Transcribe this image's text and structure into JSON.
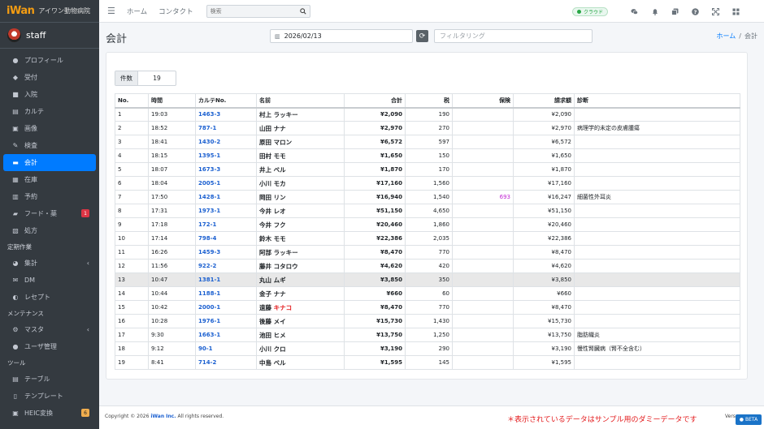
{
  "brand": {
    "logo_main": "iWan",
    "name": "アイワン動物病院"
  },
  "user": {
    "name": "staff"
  },
  "sidebar": {
    "items": [
      {
        "name": "profile",
        "label": "プロフィール",
        "icon": "user-icon",
        "glyph": "●"
      },
      {
        "name": "reception",
        "label": "受付",
        "icon": "dog-icon",
        "glyph": "◆"
      },
      {
        "name": "admission",
        "label": "入院",
        "icon": "bed-icon",
        "glyph": "■"
      },
      {
        "name": "karte",
        "label": "カルテ",
        "icon": "file-icon",
        "glyph": "▤"
      },
      {
        "name": "images",
        "label": "画像",
        "icon": "image-icon",
        "glyph": "▣"
      },
      {
        "name": "exam",
        "label": "検査",
        "icon": "syringe-icon",
        "glyph": "✎"
      },
      {
        "name": "accounting",
        "label": "会計",
        "icon": "card-icon",
        "glyph": "▬",
        "active": true
      },
      {
        "name": "inventory",
        "label": "在庫",
        "icon": "box-icon",
        "glyph": "▦"
      },
      {
        "name": "appointment",
        "label": "予約",
        "icon": "calendar-icon",
        "glyph": "▥"
      },
      {
        "name": "food",
        "label": "フード・薬",
        "icon": "folder-icon",
        "glyph": "▰",
        "badge": "1"
      },
      {
        "name": "prescription",
        "label": "処方",
        "icon": "pill-icon",
        "glyph": "▧"
      }
    ],
    "header_periodic": "定期作業",
    "periodic_items": [
      {
        "name": "aggregate",
        "label": "集計",
        "icon": "chart-pie-icon",
        "glyph": "◕",
        "chevron": "‹"
      },
      {
        "name": "dm",
        "label": "DM",
        "icon": "mail-icon",
        "glyph": "✉"
      },
      {
        "name": "receipt",
        "label": "レセプト",
        "icon": "circle-half-icon",
        "glyph": "◐"
      }
    ],
    "header_maintenance": "メンテナンス",
    "maintenance_items": [
      {
        "name": "master",
        "label": "マスタ",
        "icon": "gear-icon",
        "glyph": "⚙",
        "chevron": "‹"
      },
      {
        "name": "user-admin",
        "label": "ユーザ管理",
        "icon": "users-icon",
        "glyph": "●"
      }
    ],
    "header_tools": "ツール",
    "tool_items": [
      {
        "name": "table",
        "label": "テーブル",
        "icon": "table-icon",
        "glyph": "▤"
      },
      {
        "name": "template",
        "label": "テンプレート",
        "icon": "doc-icon",
        "glyph": "▯"
      },
      {
        "name": "heic",
        "label": "HEIC変換",
        "icon": "image-icon",
        "glyph": "▣",
        "badge_yellow": "6"
      }
    ]
  },
  "topbar": {
    "home_label": "ホーム",
    "contact_label": "コンタクト",
    "search_placeholder": "検索",
    "cloud_label": "クラウド"
  },
  "header": {
    "title": "会計",
    "date": "2026/02/13",
    "filter_placeholder": "フィルタリング",
    "breadcrumb_home": "ホーム",
    "breadcrumb_current": "会計"
  },
  "summary": {
    "count_label": "件数",
    "count_value": "19"
  },
  "table": {
    "headers": [
      "No.",
      "時間",
      "カルテNo.",
      "名前",
      "合計",
      "税",
      "保険",
      "請求額",
      "診断"
    ],
    "rows": [
      {
        "no": "1",
        "time": "19:03",
        "karte": "1463-3",
        "name": "村上 ラッキー",
        "total": "¥2,090",
        "tax": "190",
        "ins": "",
        "bill": "¥2,090",
        "diag": ""
      },
      {
        "no": "2",
        "time": "18:52",
        "karte": "787-1",
        "name": "山田 ナナ",
        "total": "¥2,970",
        "tax": "270",
        "ins": "",
        "bill": "¥2,970",
        "diag": "病理学的未定の皮膚腫瘍"
      },
      {
        "no": "3",
        "time": "18:41",
        "karte": "1430-2",
        "name": "原田 マロン",
        "total": "¥6,572",
        "tax": "597",
        "ins": "",
        "bill": "¥6,572",
        "diag": ""
      },
      {
        "no": "4",
        "time": "18:15",
        "karte": "1395-1",
        "name": "田村 モモ",
        "total": "¥1,650",
        "tax": "150",
        "ins": "",
        "bill": "¥1,650",
        "diag": ""
      },
      {
        "no": "5",
        "time": "18:07",
        "karte": "1673-3",
        "name": "井上 ベル",
        "total": "¥1,870",
        "tax": "170",
        "ins": "",
        "bill": "¥1,870",
        "diag": ""
      },
      {
        "no": "6",
        "time": "18:04",
        "karte": "2005-1",
        "name": "小川 モカ",
        "total": "¥17,160",
        "tax": "1,560",
        "ins": "",
        "bill": "¥17,160",
        "diag": ""
      },
      {
        "no": "7",
        "time": "17:50",
        "karte": "1428-1",
        "name": "岡田 リン",
        "total": "¥16,940",
        "tax": "1,540",
        "ins": "693",
        "bill": "¥16,247",
        "diag": "細菌性外耳炎"
      },
      {
        "no": "8",
        "time": "17:31",
        "karte": "1973-1",
        "name": "今井 レオ",
        "total": "¥51,150",
        "tax": "4,650",
        "ins": "",
        "bill": "¥51,150",
        "diag": ""
      },
      {
        "no": "9",
        "time": "17:18",
        "karte": "172-1",
        "name": "今井 フク",
        "total": "¥20,460",
        "tax": "1,860",
        "ins": "",
        "bill": "¥20,460",
        "diag": ""
      },
      {
        "no": "10",
        "time": "17:14",
        "karte": "798-4",
        "name": "鈴木 モモ",
        "total": "¥22,386",
        "tax": "2,035",
        "ins": "",
        "bill": "¥22,386",
        "diag": ""
      },
      {
        "no": "11",
        "time": "16:26",
        "karte": "1459-3",
        "name": "阿部 ラッキー",
        "total": "¥8,470",
        "tax": "770",
        "ins": "",
        "bill": "¥8,470",
        "diag": ""
      },
      {
        "no": "12",
        "time": "11:56",
        "karte": "922-2",
        "name": "藤井 コタロウ",
        "total": "¥4,620",
        "tax": "420",
        "ins": "",
        "bill": "¥4,620",
        "diag": ""
      },
      {
        "no": "13",
        "time": "10:47",
        "karte": "1381-1",
        "name": "丸山 ムギ",
        "total": "¥3,850",
        "tax": "350",
        "ins": "",
        "bill": "¥3,850",
        "diag": "",
        "highlight": true
      },
      {
        "no": "14",
        "time": "10:44",
        "karte": "1188-1",
        "name": "金子 ナナ",
        "total": "¥660",
        "tax": "60",
        "ins": "",
        "bill": "¥660",
        "diag": ""
      },
      {
        "no": "15",
        "time": "10:42",
        "karte": "2000-1",
        "name": "遠藤",
        "name_red": "キナコ",
        "total": "¥8,470",
        "tax": "770",
        "ins": "",
        "bill": "¥8,470",
        "diag": ""
      },
      {
        "no": "16",
        "time": "10:28",
        "karte": "1976-1",
        "name": "後藤 メイ",
        "total": "¥15,730",
        "tax": "1,430",
        "ins": "",
        "bill": "¥15,730",
        "diag": ""
      },
      {
        "no": "17",
        "time": "9:30",
        "karte": "1663-1",
        "name": "池田 ヒメ",
        "total": "¥13,750",
        "tax": "1,250",
        "ins": "",
        "bill": "¥13,750",
        "diag": "脂肪織炎"
      },
      {
        "no": "18",
        "time": "9:12",
        "karte": "90-1",
        "name": "小川 クロ",
        "total": "¥3,190",
        "tax": "290",
        "ins": "",
        "bill": "¥3,190",
        "diag": "慢性腎臓病（腎不全含む）"
      },
      {
        "no": "19",
        "time": "8:41",
        "karte": "714-2",
        "name": "中島 ベル",
        "total": "¥1,595",
        "tax": "145",
        "ins": "",
        "bill": "¥1,595",
        "diag": ""
      }
    ]
  },
  "footer": {
    "copyright_prefix": "Copyright © 2026 ",
    "company": "iWan Inc.",
    "rights": " All rights reserved.",
    "notice": "＊表示されているデータはサンプル用のダミーデータです",
    "version_label": "Vers",
    "beta_label": "BETA"
  },
  "colors": {
    "accent": "#007bff",
    "sidebar_bg": "#343a40",
    "link": "#1a5fd0",
    "insurance": "#c026d3",
    "notice": "#e31a1c"
  }
}
